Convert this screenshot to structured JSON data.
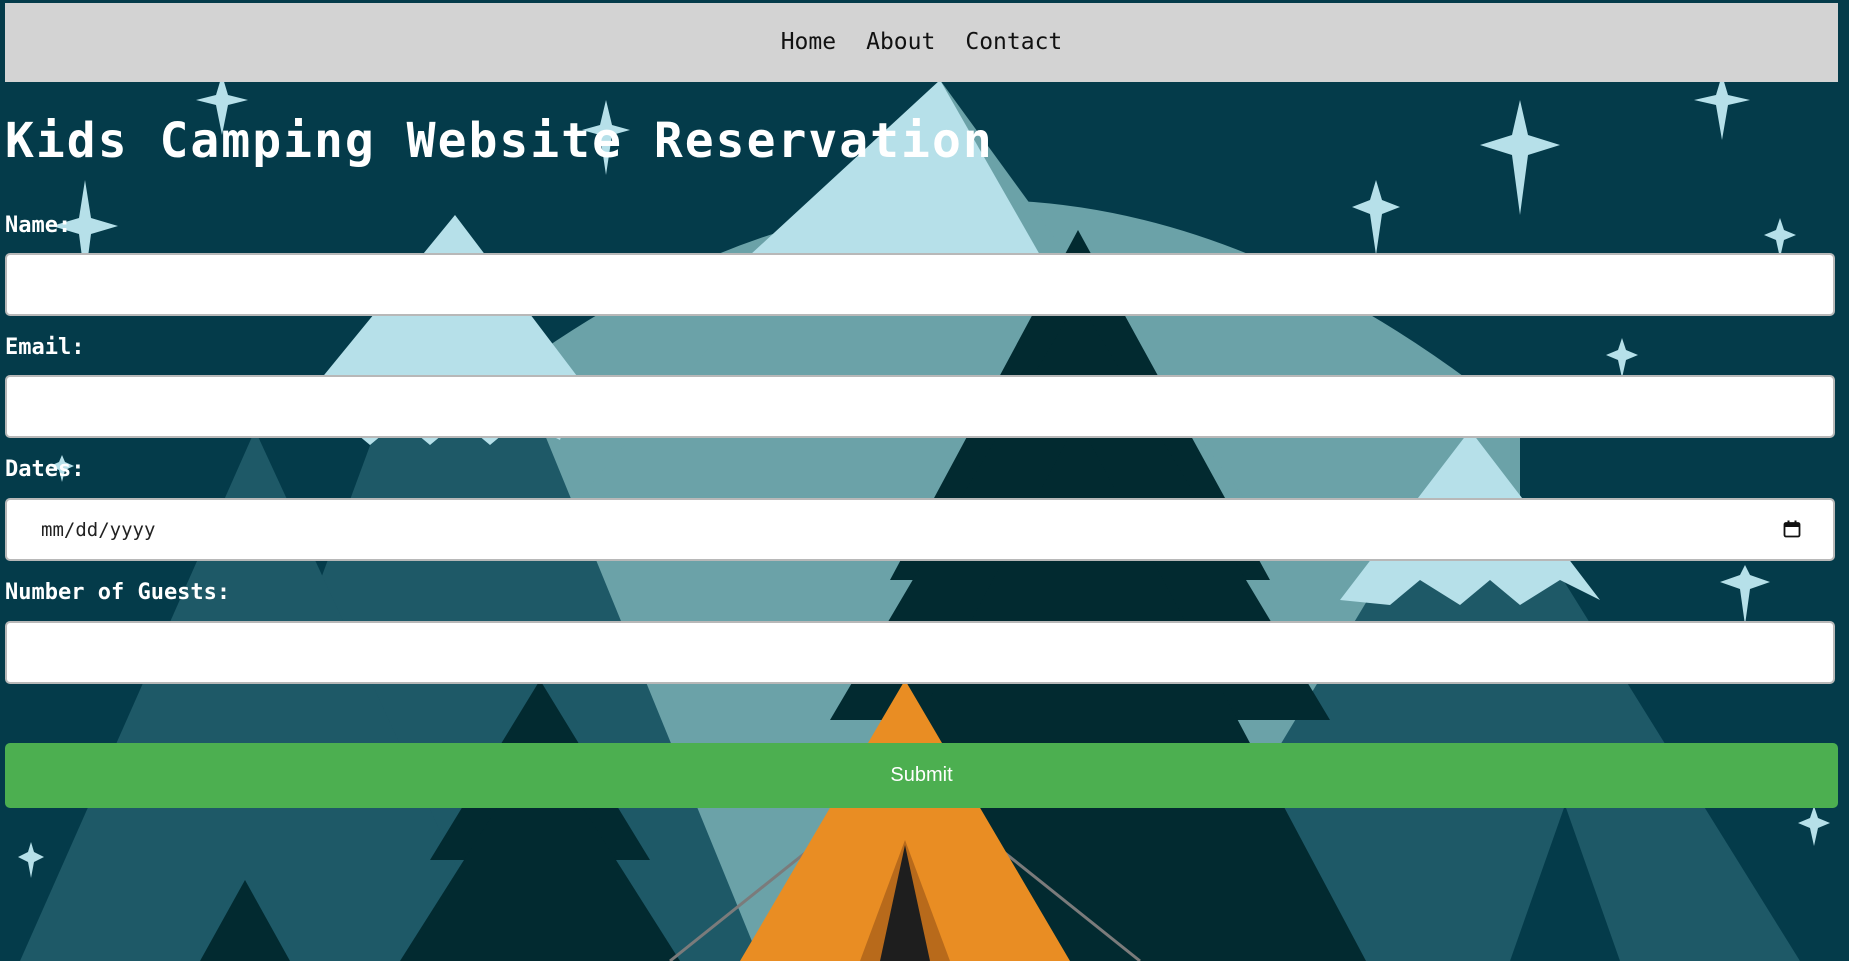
{
  "nav": {
    "items": [
      {
        "label": "Home"
      },
      {
        "label": "About"
      },
      {
        "label": "Contact"
      }
    ]
  },
  "page": {
    "title": "Kids Camping Website Reservation"
  },
  "form": {
    "name_label": "Name:",
    "name_value": "",
    "email_label": "Email:",
    "email_value": "",
    "dates_label": "Dates:",
    "dates_placeholder": "mm/dd/yyyy",
    "guests_label": "Number of Guests:",
    "guests_value": "",
    "submit_label": "Submit"
  },
  "icons": {
    "date_picker": "calendar-icon"
  },
  "colors": {
    "background": "#043b4a",
    "navbar": "#d3d3d3",
    "submit": "#4caf50",
    "tent": "#e98d23",
    "snowcap": "#b6e0e9",
    "mountain": "#6ba2a8",
    "tree_dark": "#022a30"
  }
}
